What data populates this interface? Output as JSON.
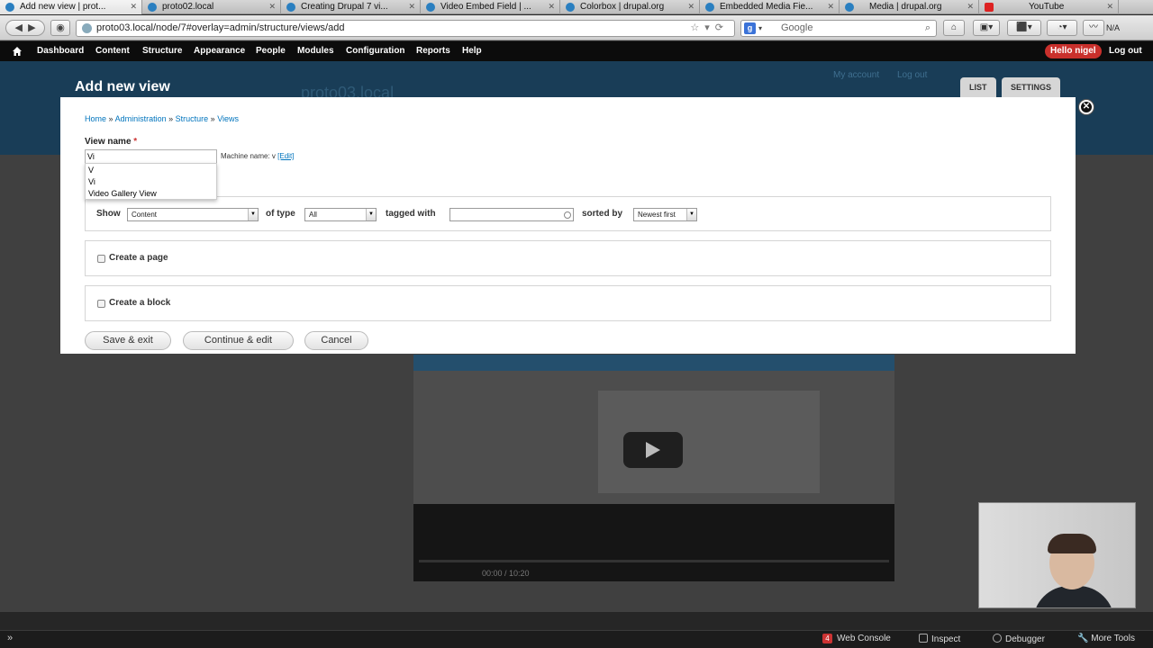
{
  "browser": {
    "tabs": [
      {
        "title": "Add new view | prot...",
        "active": true,
        "icon": "drupal-icon"
      },
      {
        "title": "proto02.local",
        "active": false,
        "icon": "drupal-icon"
      },
      {
        "title": "Creating Drupal 7 vi...",
        "active": false,
        "icon": "drupal-icon"
      },
      {
        "title": "Video Embed Field | ...",
        "active": false,
        "icon": "drupal-icon"
      },
      {
        "title": "Colorbox | drupal.org",
        "active": false,
        "icon": "drupal-icon"
      },
      {
        "title": "Embedded Media Fie...",
        "active": false,
        "icon": "drupal-icon"
      },
      {
        "title": "Media | drupal.org",
        "active": false,
        "icon": "drupal-icon"
      },
      {
        "title": "YouTube",
        "active": false,
        "icon": "youtube-icon"
      }
    ],
    "url": "proto03.local/node/7#overlay=admin/structure/views/add",
    "search_placeholder": "Google",
    "na_label": "N/A"
  },
  "admin_toolbar": {
    "items": [
      "Dashboard",
      "Content",
      "Structure",
      "Appearance",
      "People",
      "Modules",
      "Configuration",
      "Reports",
      "Help"
    ],
    "hello": "Hello nigel",
    "logout": "Log out"
  },
  "page": {
    "title": "Add new view",
    "site_name": "proto03.local",
    "my_account": "My account",
    "log_out": "Log out",
    "tab_list": "LIST",
    "tab_settings": "SETTINGS",
    "video_time": "00:00 / 10:20"
  },
  "form": {
    "breadcrumb": [
      "Home",
      "Administration",
      "Structure",
      "Views"
    ],
    "breadcrumb_sep": "»",
    "view_name_label": "View name",
    "required_mark": "*",
    "view_name_value": "Vi",
    "machine_name_label": "Machine name: v",
    "machine_name_edit": "[Edit]",
    "autocomplete": [
      "V",
      "Vi",
      "Video Gallery View"
    ],
    "show_label": "Show",
    "show_value": "Content",
    "of_type_label": "of type",
    "of_type_value": "All",
    "tagged_with_label": "tagged with",
    "sorted_by_label": "sorted by",
    "sorted_by_value": "Newest first",
    "create_page_label": "Create a page",
    "create_block_label": "Create a block",
    "buttons": {
      "save_exit": "Save & exit",
      "continue_edit": "Continue & edit",
      "cancel": "Cancel"
    }
  },
  "devtools": {
    "web_console": "Web Console",
    "error_count": "4",
    "inspect": "Inspect",
    "debugger": "Debugger",
    "more_tools": "More Tools"
  },
  "colors": {
    "admin_toolbar_bg": "#0c0c0c",
    "header_bg": "#193d57",
    "link_blue": "#0074bd",
    "hello_badge": "#c9302c"
  }
}
